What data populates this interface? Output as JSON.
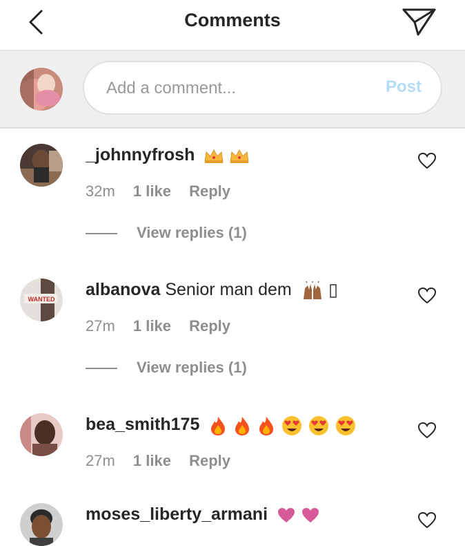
{
  "header": {
    "title": "Comments",
    "back_icon": "chevron-left-icon",
    "send_icon": "paper-plane-icon"
  },
  "composer": {
    "placeholder": "Add a comment...",
    "post_label": "Post",
    "post_color": "#b3dcf6"
  },
  "comments": [
    {
      "username": "_johnnyfrosh",
      "text": "",
      "emojis": "👑👑",
      "time": "32m",
      "likes": "1 like",
      "reply": "Reply",
      "view_replies": "View replies (1)"
    },
    {
      "username": "albanova",
      "text": "Senior man dem",
      "emojis": "🙌🏽▯",
      "avatar_text": "WANTED",
      "time": "27m",
      "likes": "1 like",
      "reply": "Reply",
      "view_replies": "View replies (1)"
    },
    {
      "username": "bea_smith175",
      "text": "",
      "emojis": "🔥🔥🔥😍😍😍",
      "time": "27m",
      "likes": "1 like",
      "reply": "Reply"
    },
    {
      "username": "moses_liberty_armani",
      "text": "",
      "emojis": "💗💗"
    }
  ],
  "colors": {
    "text": "#262626",
    "secondary": "#8e8e8e",
    "like_heart_outline": "#262626",
    "pink_heart": "#d65a9a"
  }
}
